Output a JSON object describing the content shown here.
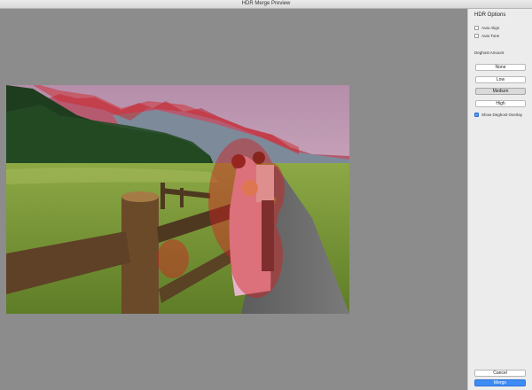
{
  "window": {
    "title": "HDR Merge Preview"
  },
  "options": {
    "title": "HDR Options",
    "auto_align": {
      "label": "Auto Align",
      "checked": false
    },
    "auto_tone": {
      "label": "Auto Tone",
      "checked": false
    },
    "deghost_label": "Deghost Amount",
    "deghost_levels": [
      "None",
      "Low",
      "Medium",
      "High"
    ],
    "deghost_selected": "Medium",
    "overlay": {
      "label": "Show Deghost Overlay",
      "checked": true
    }
  },
  "actions": {
    "cancel": "Cancel",
    "merge": "Merge"
  },
  "colors": {
    "accent": "#3d8bf6",
    "overlay": "#d22020"
  }
}
